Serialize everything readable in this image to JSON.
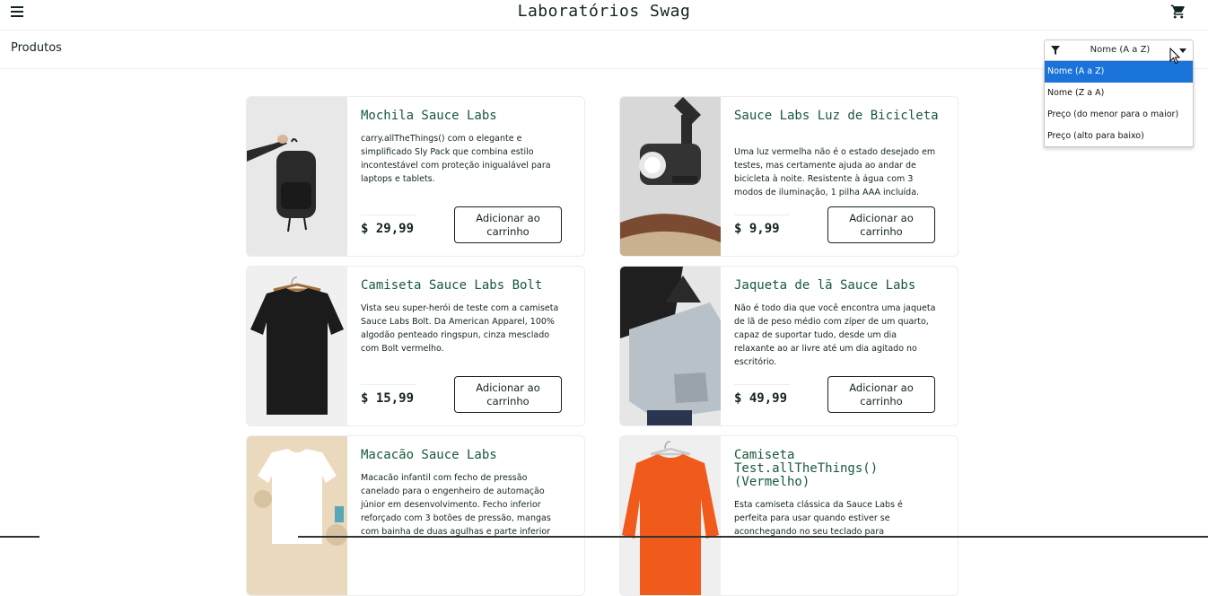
{
  "header": {
    "app_title": "Laboratórios Swag",
    "menu_icon": "hamburger-menu-icon",
    "cart_icon": "shopping-cart-icon"
  },
  "subheader": {
    "title": "Produtos",
    "sort": {
      "selected": "Nome (A a Z)",
      "filter_icon": "filter-icon",
      "options": [
        "Nome (A a Z)",
        "Nome (Z a A)",
        "Preço (do menor para o maior)",
        "Preço (alto para baixo)"
      ]
    }
  },
  "colors": {
    "product_name": "#18583a",
    "selected_option": "#1a73d9",
    "text": "#132322"
  },
  "products": [
    {
      "name": "Mochila Sauce Labs",
      "desc": "carry.allTheThings() com o elegante e simplificado Sly Pack que combina estilo incontestável com proteção inigualável para laptops e tablets.",
      "price": "$ 29,99",
      "button": "Adicionar ao carrinho",
      "image": "backpack-image"
    },
    {
      "name": "Sauce Labs Luz de Bicicleta",
      "desc": "Uma luz vermelha não é o estado desejado em testes, mas certamente ajuda ao andar de bicicleta à noite. Resistente à água com 3 modos de iluminação, 1 pilha AAA incluída.",
      "price": "$ 9,99",
      "button": "Adicionar ao carrinho",
      "image": "bike-light-image"
    },
    {
      "name": "Camiseta Sauce Labs Bolt",
      "desc": "Vista seu super-herói de teste com a camiseta Sauce Labs Bolt. Da American Apparel, 100% algodão penteado ringspun, cinza mesclado com Bolt vermelho.",
      "price": "$ 15,99",
      "button": "Adicionar ao carrinho",
      "image": "bolt-tshirt-image"
    },
    {
      "name": "Jaqueta de lã Sauce Labs",
      "desc": "Não é todo dia que você encontra uma jaqueta de lã de peso médio com zíper de um quarto, capaz de suportar tudo, desde um dia relaxante ao ar livre até um dia agitado no escritório.",
      "price": "$ 49,99",
      "button": "Adicionar ao carrinho",
      "image": "fleece-jacket-image"
    },
    {
      "name": "Macacão Sauce Labs",
      "desc": "Macacão infantil com fecho de pressão canelado para o engenheiro de automação júnior em desenvolvimento. Fecho inferior reforçado com 3 botões de pressão, mangas com bainha de duas agulhas e parte inferior",
      "price": "",
      "button": "",
      "image": "onesie-image"
    },
    {
      "name": "Camiseta Test.allTheThings() (Vermelho)",
      "desc": "Esta camiseta clássica da Sauce Labs é perfeita para usar quando estiver se aconchegando no seu teclado para",
      "price": "",
      "button": "",
      "image": "red-tshirt-image"
    }
  ]
}
